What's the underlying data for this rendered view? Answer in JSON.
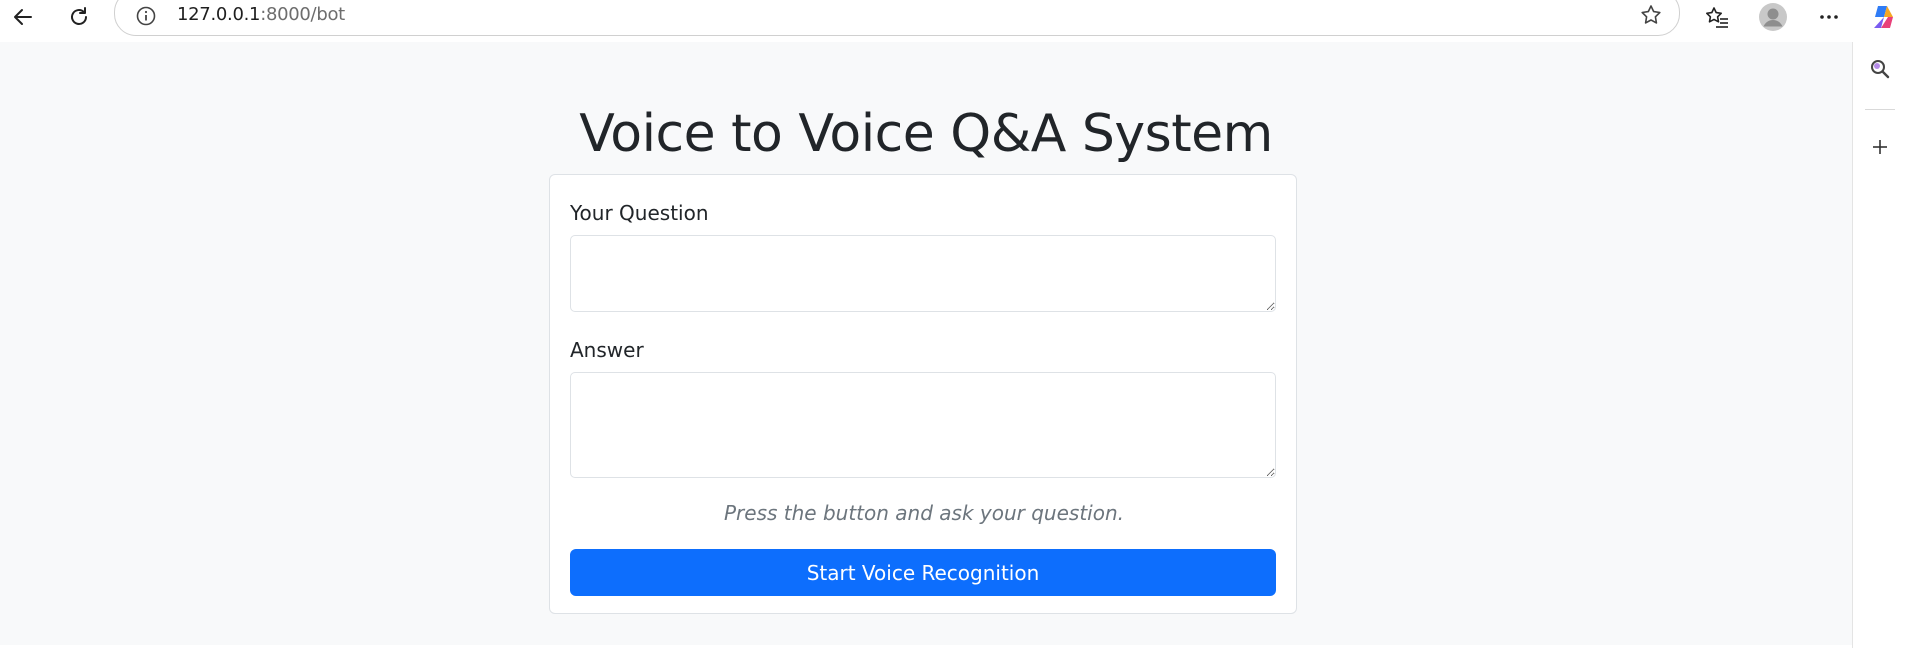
{
  "browser": {
    "url_host": "127.0.0.1",
    "url_path": ":8000/bot",
    "icons": {
      "back": "back-arrow-icon",
      "reload": "reload-icon",
      "info": "info-icon",
      "favorite": "star-icon",
      "favorites": "favorites-icon",
      "profile": "profile-icon",
      "more": "more-icon",
      "copilot": "copilot-icon"
    }
  },
  "sidebar": {
    "icons": [
      "search-icon",
      "plus-icon"
    ]
  },
  "main": {
    "title": "Voice to Voice Q&A System",
    "question_label": "Your Question",
    "question_value": "",
    "answer_label": "Answer",
    "answer_value": "",
    "status_text": "Press the button and ask your question.",
    "button_label": "Start Voice Recognition"
  },
  "colors": {
    "page_background": "#f8f9fa",
    "primary_button": "#0d6efd",
    "text": "#212529",
    "muted_text": "#6c757d"
  }
}
